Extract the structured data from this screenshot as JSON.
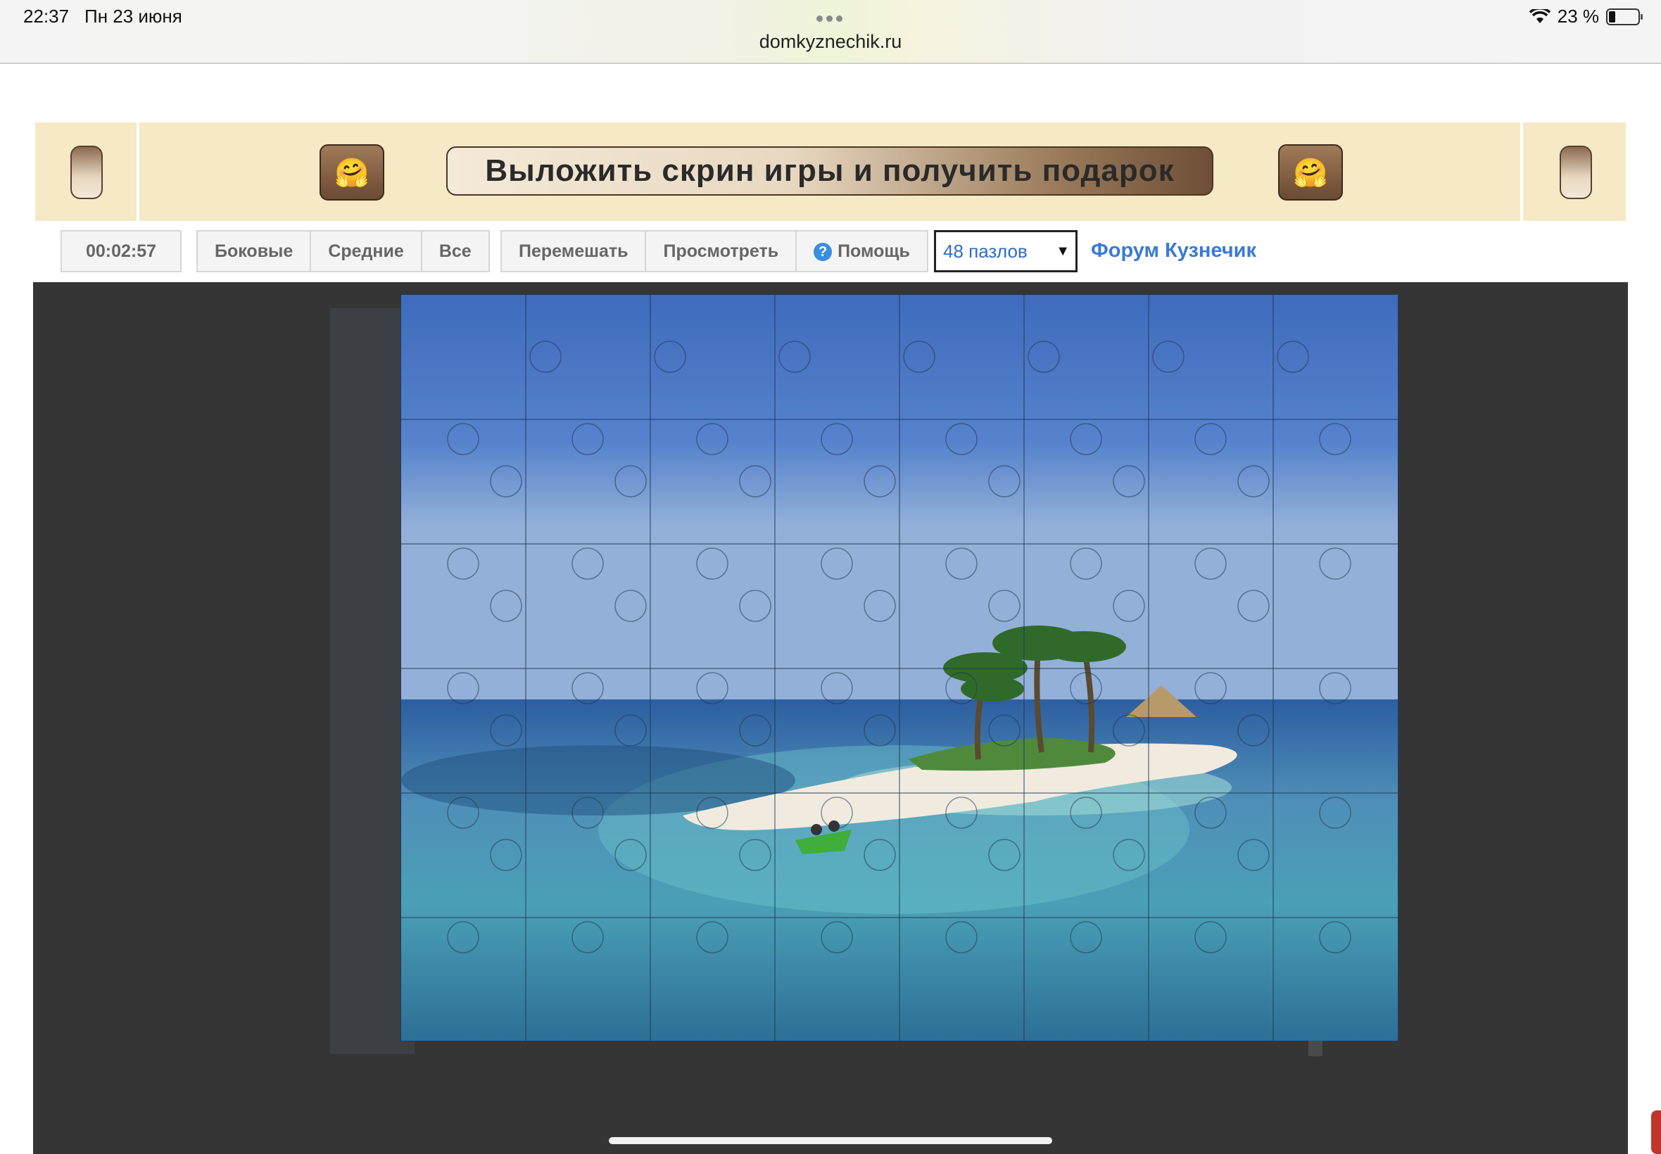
{
  "status_bar": {
    "time": "22:37",
    "date": "Пн 23 июня",
    "url": "domkyznechik.ru",
    "battery": "23 %",
    "icons": [
      "wifi-icon",
      "battery-icon",
      "more-dots-icon"
    ]
  },
  "banner": {
    "title": "Выложить скрин игры и получить подарок",
    "emoji": "🤗"
  },
  "toolbar": {
    "timer": "00:02:57",
    "filter_buttons": [
      "Боковые",
      "Средние",
      "Все"
    ],
    "shuffle": "Перемешать",
    "preview": "Просмотреть",
    "help": "Помощь",
    "pieces_select": "48 пазлов",
    "forum_link": "Форум Кузнечик"
  },
  "puzzle": {
    "pieces_total": 48,
    "columns": 8,
    "rows": 6,
    "image": "tropical island with palm trees and kayak"
  },
  "colors": {
    "banner_bg": "#f5e9c6",
    "game_bg": "#353535",
    "link": "#3a7ad8"
  }
}
